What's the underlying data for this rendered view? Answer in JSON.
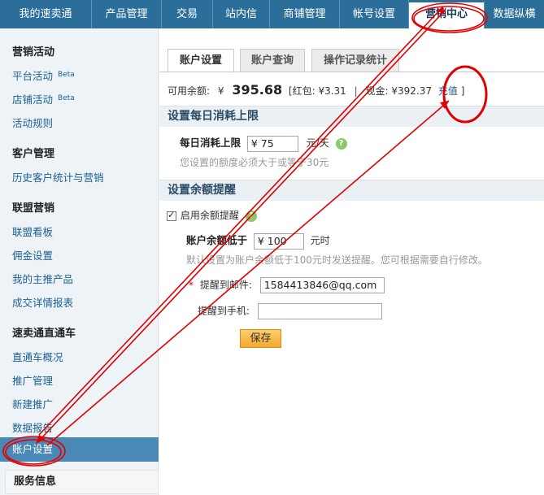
{
  "topnav": {
    "items": [
      {
        "label": "我的速卖通"
      },
      {
        "label": "产品管理"
      },
      {
        "label": "交易"
      },
      {
        "label": "站内信"
      },
      {
        "label": "商铺管理"
      },
      {
        "label": "帐号设置"
      },
      {
        "label": "营销中心"
      },
      {
        "label": "数据纵横"
      }
    ],
    "active_color": "#1a3b58",
    "bar_color": "#2b6e99"
  },
  "sidebar": {
    "sections": [
      {
        "title": "营销活动",
        "links": [
          {
            "label": "平台活动",
            "badge": "Beta"
          },
          {
            "label": "店铺活动",
            "badge": "Beta"
          },
          {
            "label": "活动规则"
          }
        ]
      },
      {
        "title": "客户管理",
        "links": [
          {
            "label": "历史客户统计与营销"
          }
        ]
      },
      {
        "title": "联盟营销",
        "links": [
          {
            "label": "联盟看板"
          },
          {
            "label": "佣金设置"
          },
          {
            "label": "我的主推产品"
          },
          {
            "label": "成交详情报表"
          }
        ]
      },
      {
        "title": "速卖通直通车",
        "links": [
          {
            "label": "直通车概况"
          },
          {
            "label": "推广管理"
          },
          {
            "label": "新建推广"
          },
          {
            "label": "数据报告"
          }
        ]
      }
    ],
    "active_item": "账户设置",
    "bottom_section": "服务信息"
  },
  "tabs": [
    {
      "label": "账户设置"
    },
    {
      "label": "账户查询"
    },
    {
      "label": "操作记录统计"
    }
  ],
  "balance": {
    "label": "可用余额:",
    "currency": "¥",
    "amount": "395.68",
    "red_packet": "[红包: ¥3.31",
    "divider": "|",
    "cash": "现金: ¥392.37",
    "recharge": "充值",
    "close_bracket": "]"
  },
  "daily_limit": {
    "section_title": "设置每日消耗上限",
    "label": "每日消耗上限",
    "value": "¥ 75",
    "unit": "元/天",
    "hint": "您设置的额度必须大于或等于30元"
  },
  "balance_alert": {
    "section_title": "设置余额提醒",
    "enable_label": "启用余额提醒",
    "threshold_label": "账户余额低于",
    "threshold_value": "¥ 100",
    "threshold_unit": "元时",
    "hint": "默认设置为账户余额低于100元时发送提醒。您可根据需要自行修改。",
    "required_mark": "*",
    "email_label": "提醒到邮件:",
    "email_value": "1584413846@qq.com",
    "phone_label": "提醒到手机:",
    "phone_value": "",
    "help_icon": "?"
  },
  "save_button": "保存",
  "annotation_color": "#e00000"
}
